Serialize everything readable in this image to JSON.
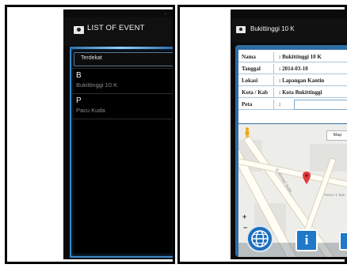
{
  "left_screen": {
    "title": "LIST OF EVENT",
    "search_value": "Terdekat",
    "events": [
      {
        "letter": "B",
        "name": "Bukittinggi 10 K"
      },
      {
        "letter": "P",
        "name": "Pacu Kuda"
      }
    ]
  },
  "right_screen": {
    "title": "Bukittinggi 10 K",
    "details": [
      {
        "label": "Nama",
        "value": ": Bukittinggi 10 K"
      },
      {
        "label": "Tanggal",
        "value": ": 2014-03-10"
      },
      {
        "label": "Lokasi",
        "value": ": Lapangan Kantin"
      },
      {
        "label": "Kota / Kab",
        "value": ": Kota Bukittinggi"
      },
      {
        "label": "Peta",
        "value": ":"
      }
    ],
    "map": {
      "type_button": "Map",
      "zoom_in": "+",
      "zoom_out": "−",
      "street_label": "Jl. Ahmad Suda...",
      "place_label": "Panca T. Buk"
    },
    "info_button_label": "i"
  },
  "colors": {
    "accent_blue": "#2f6ea3",
    "marker_red": "#e23a3a",
    "background_black": "#0b0b0b"
  },
  "icons": [
    "camera-icon",
    "globe-icon",
    "info-icon",
    "image-icon",
    "pegman-icon",
    "map-marker-icon"
  ]
}
